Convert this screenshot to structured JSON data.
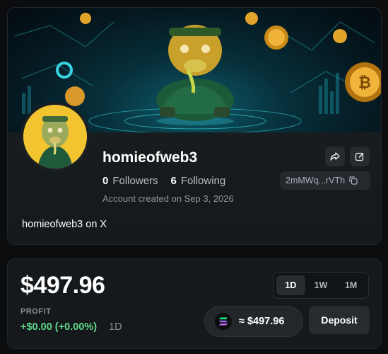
{
  "profile": {
    "username": "homieofweb3",
    "followers_count": "0",
    "followers_label": "Followers",
    "following_count": "6",
    "following_label": "Following",
    "created": "Account created on Sep 3, 2026",
    "wallet_short": "2mMWq...rVTh",
    "bio": "homieofweb3 on X"
  },
  "balance": {
    "amount": "$497.96",
    "profit_label": "PROFIT",
    "profit_value": "+$0.00 (+0.00%)",
    "profit_period": "1D",
    "ranges": [
      {
        "label": "1D",
        "active": true
      },
      {
        "label": "1W",
        "active": false
      },
      {
        "label": "1M",
        "active": false
      }
    ],
    "sol_value": "≈ $497.96",
    "deposit_label": "Deposit"
  },
  "colors": {
    "profit_green": "#5fd88a",
    "avatar_bg": "#f2c530",
    "banner_teal": "#0e5b6a"
  }
}
